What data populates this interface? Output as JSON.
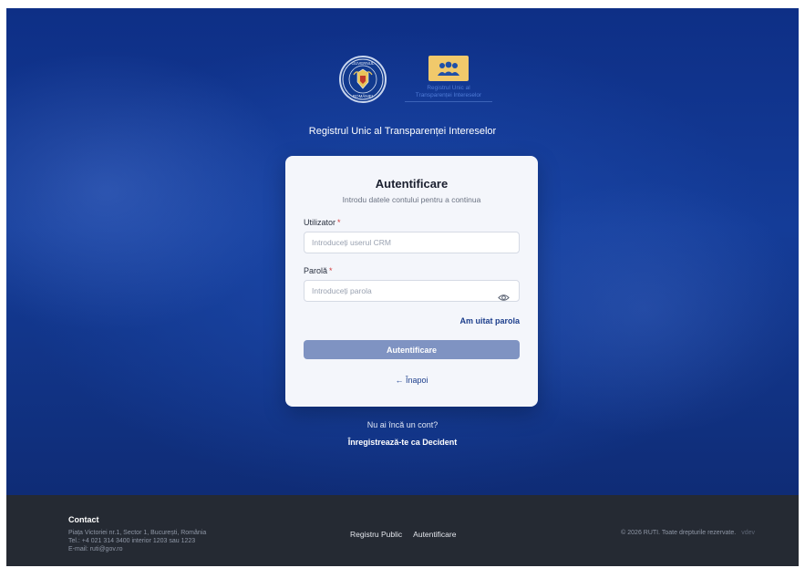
{
  "site": {
    "title": "Registrul Unic al Transparenței Intereselor",
    "ruti_logo_text_1": "Registrul Unic al",
    "ruti_logo_text_2": "Transparenței Intereselor",
    "seal_text_top": "GUVERNUL",
    "seal_text_bottom": "ROMÂNIEI"
  },
  "login": {
    "title": "Autentificare",
    "subtitle": "Introdu datele contului pentru a continua",
    "username_label": "Utilizator",
    "username_placeholder": "Introduceți userul CRM",
    "password_label": "Parolă",
    "password_placeholder": "Introduceți parola",
    "required_mark": "*",
    "forgot_label": "Am uitat parola",
    "submit_label": "Autentificare",
    "back_label": "← Înapoi"
  },
  "signup": {
    "prompt": "Nu ai încă un cont?",
    "link_label": "Înregistrează-te ca Decident"
  },
  "footer": {
    "contact_title": "Contact",
    "address": "Piața Victoriei nr.1, Sector 1, București, România",
    "phone": "Tel.: +4 021 314 3400 interior 1203 sau 1223",
    "email": "E-mail: ruti@gov.ro",
    "links": [
      "Registru Public",
      "Autentificare"
    ],
    "copyright": "© 2026 RUTI. Toate drepturile rezervate.",
    "version": "vdev"
  },
  "colors": {
    "brand_blue": "#143c98",
    "button_disabled": "#7f93c2",
    "footer_bg": "#252a33",
    "logo_yellow": "#f1c96b"
  },
  "icons": {
    "seal": "romanian-government-seal-icon",
    "ruti": "people-group-icon",
    "eye": "eye-icon"
  }
}
